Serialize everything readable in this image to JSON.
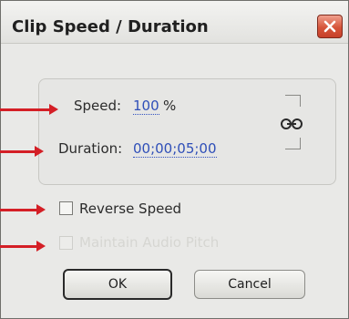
{
  "dialog": {
    "title": "Clip Speed / Duration",
    "close_icon": "close-x-icon"
  },
  "speed": {
    "label": "Speed:",
    "value": "100",
    "unit": "%"
  },
  "duration": {
    "label": "Duration:",
    "value": "00;00;05;00"
  },
  "link_icon": "chain-link-icon",
  "reverse_speed": {
    "label": "Reverse Speed",
    "checked": false
  },
  "maintain_audio_pitch": {
    "label": "Maintain Audio Pitch",
    "enabled": false
  },
  "buttons": {
    "ok": "OK",
    "cancel": "Cancel"
  },
  "colors": {
    "annotation_arrow": "#d41f26",
    "value_link": "#2f4fb8",
    "close_button": "#d6553a"
  }
}
